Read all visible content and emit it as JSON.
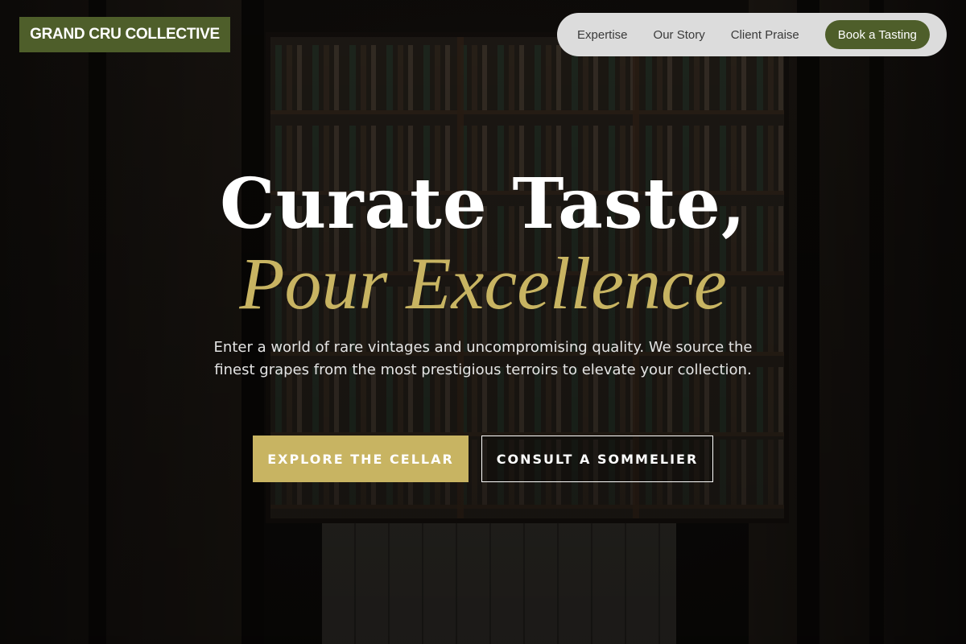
{
  "brand": {
    "name": "GRAND CRU COLLECTIVE"
  },
  "nav": {
    "links": [
      {
        "label": "Expertise"
      },
      {
        "label": "Our Story"
      },
      {
        "label": "Client Praise"
      }
    ],
    "cta_label": "Book a Tasting"
  },
  "hero": {
    "headline_line1": "Curate Taste,",
    "headline_line2": "Pour Excellence",
    "subtitle": "Enter a world of rare vintages and uncompromising quality. We source the finest grapes from the most prestigious terroirs to elevate your collection.",
    "primary_button": "EXPLORE THE CELLAR",
    "secondary_button": "CONSULT A SOMMELIER"
  },
  "colors": {
    "brand_green": "#4e5e2a",
    "accent_gold": "#c8b462",
    "nav_pill": "#dcdcdc"
  }
}
